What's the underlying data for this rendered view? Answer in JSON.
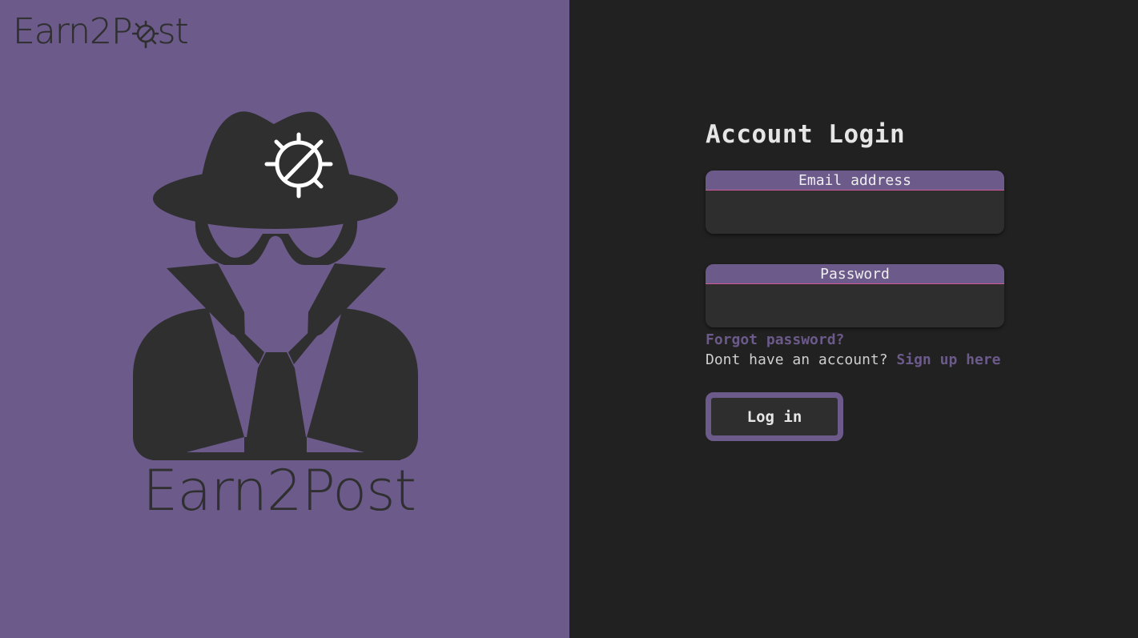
{
  "brand": {
    "name": "Earn2Post"
  },
  "colors": {
    "accent": "#6b5a8a",
    "background": "#212121",
    "field": "#2e2e2e",
    "divider": "#d05a9a"
  },
  "login": {
    "title": "Account Login",
    "email_label": "Email address",
    "email_value": "",
    "password_label": "Password",
    "password_value": "",
    "forgot_link": "Forgot password?",
    "no_account_text": "Dont have an account?",
    "signup_link": "Sign up here",
    "submit_label": "Log in"
  },
  "icons": {
    "bug": "bug-icon",
    "spy": "spy-icon"
  }
}
